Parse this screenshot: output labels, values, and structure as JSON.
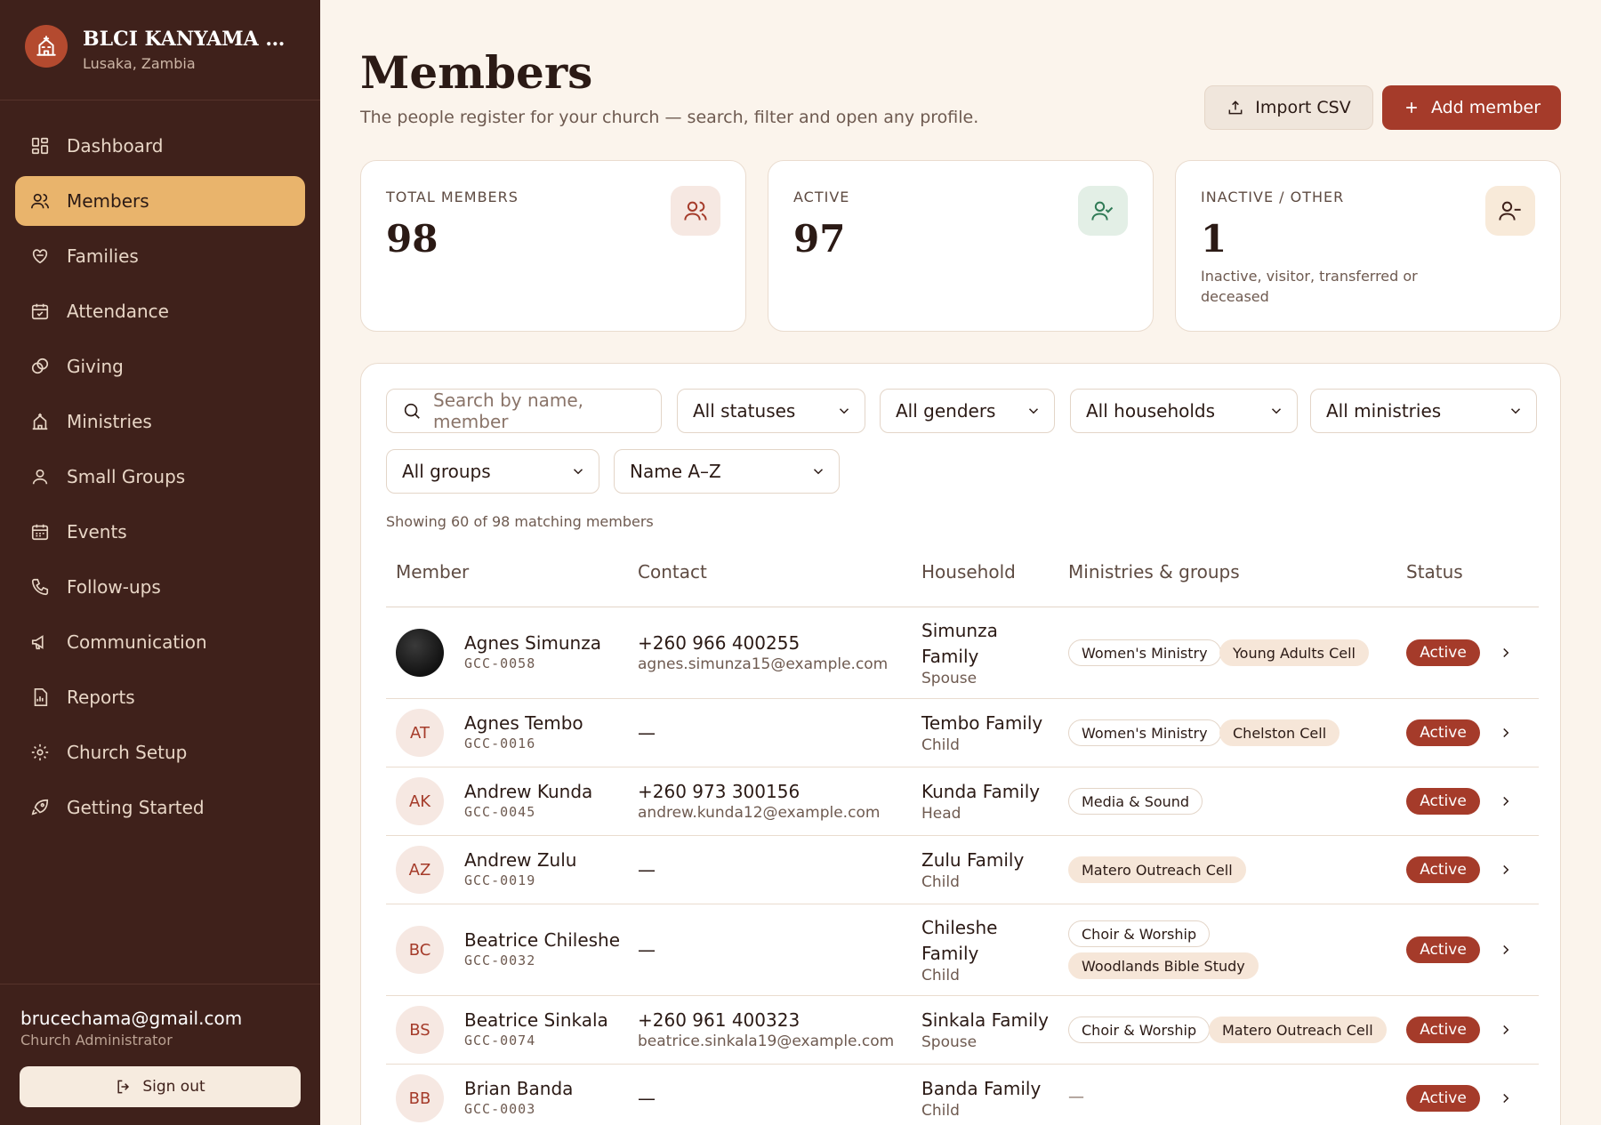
{
  "brand": {
    "name": "BLCI KANYAMA BR...",
    "location": "Lusaka, Zambia"
  },
  "nav": [
    {
      "label": "Dashboard",
      "icon": "dashboard-icon",
      "active": false
    },
    {
      "label": "Members",
      "icon": "users-icon",
      "active": true
    },
    {
      "label": "Families",
      "icon": "heart-hands-icon",
      "active": false
    },
    {
      "label": "Attendance",
      "icon": "calendar-check-icon",
      "active": false
    },
    {
      "label": "Giving",
      "icon": "coins-icon",
      "active": false
    },
    {
      "label": "Ministries",
      "icon": "church-icon",
      "active": false
    },
    {
      "label": "Small Groups",
      "icon": "user-group-icon",
      "active": false
    },
    {
      "label": "Events",
      "icon": "calendar-icon",
      "active": false
    },
    {
      "label": "Follow-ups",
      "icon": "phone-icon",
      "active": false
    },
    {
      "label": "Communication",
      "icon": "megaphone-icon",
      "active": false
    },
    {
      "label": "Reports",
      "icon": "report-icon",
      "active": false
    },
    {
      "label": "Church Setup",
      "icon": "gear-icon",
      "active": false
    },
    {
      "label": "Getting Started",
      "icon": "rocket-icon",
      "active": false
    }
  ],
  "user": {
    "email": "brucechama@gmail.com",
    "role": "Church Administrator",
    "sign_out": "Sign out"
  },
  "header": {
    "title": "Members",
    "subtitle": "The people register for your church — search, filter and open any profile.",
    "import_label": "Import CSV",
    "add_label": "Add member"
  },
  "stats": {
    "total": {
      "label": "TOTAL MEMBERS",
      "value": "98"
    },
    "active": {
      "label": "ACTIVE",
      "value": "97"
    },
    "inactive": {
      "label": "INACTIVE / OTHER",
      "value": "1",
      "note": "Inactive, visitor, transferred or deceased"
    }
  },
  "filters": {
    "search_placeholder": "Search by name, member",
    "status": "All statuses",
    "gender": "All genders",
    "household": "All households",
    "ministry": "All ministries",
    "group": "All groups",
    "sort": "Name A–Z"
  },
  "showing": "Showing 60 of 98 matching members",
  "columns": {
    "member": "Member",
    "contact": "Contact",
    "household": "Household",
    "ministries": "Ministries & groups",
    "status": "Status"
  },
  "members": [
    {
      "initials": "",
      "photo": true,
      "name": "Agnes Simunza",
      "code": "GCC-0058",
      "phone": "+260 966 400255",
      "email": "agnes.simunza15@example.com",
      "household": "Simunza Family",
      "role": "Spouse",
      "ministries": [
        "Women's Ministry"
      ],
      "groups": [
        "Young Adults Cell"
      ],
      "status": "Active"
    },
    {
      "initials": "AT",
      "photo": false,
      "name": "Agnes Tembo",
      "code": "GCC-0016",
      "phone": "",
      "email": "",
      "contact_empty": "—",
      "household": "Tembo Family",
      "role": "Child",
      "ministries": [
        "Women's Ministry"
      ],
      "groups": [
        "Chelston Cell"
      ],
      "status": "Active"
    },
    {
      "initials": "AK",
      "photo": false,
      "name": "Andrew Kunda",
      "code": "GCC-0045",
      "phone": "+260 973 300156",
      "email": "andrew.kunda12@example.com",
      "household": "Kunda Family",
      "role": "Head",
      "ministries": [
        "Media & Sound"
      ],
      "groups": [],
      "status": "Active"
    },
    {
      "initials": "AZ",
      "photo": false,
      "name": "Andrew Zulu",
      "code": "GCC-0019",
      "phone": "",
      "email": "",
      "contact_empty": "—",
      "household": "Zulu Family",
      "role": "Child",
      "ministries": [],
      "groups": [
        "Matero Outreach Cell"
      ],
      "status": "Active"
    },
    {
      "initials": "BC",
      "photo": false,
      "name": "Beatrice Chileshe",
      "code": "GCC-0032",
      "phone": "",
      "email": "",
      "contact_empty": "—",
      "household": "Chileshe Family",
      "role": "Child",
      "ministries": [
        "Choir & Worship"
      ],
      "groups": [
        "Woodlands Bible Study"
      ],
      "status": "Active"
    },
    {
      "initials": "BS",
      "photo": false,
      "name": "Beatrice Sinkala",
      "code": "GCC-0074",
      "phone": "+260 961 400323",
      "email": "beatrice.sinkala19@example.com",
      "household": "Sinkala Family",
      "role": "Spouse",
      "ministries": [
        "Choir & Worship"
      ],
      "groups": [
        "Matero Outreach Cell"
      ],
      "status": "Active"
    },
    {
      "initials": "BB",
      "photo": false,
      "name": "Brian Banda",
      "code": "GCC-0003",
      "phone": "",
      "email": "",
      "contact_empty": "—",
      "household": "Banda Family",
      "role": "Child",
      "ministries": [],
      "groups": [],
      "groups_empty": "—",
      "status": "Active"
    }
  ],
  "colors": {
    "sidebar": "#3f211b",
    "active_nav": "#e9b46c",
    "accent": "#a53b2a",
    "background": "#fbf4ec"
  }
}
